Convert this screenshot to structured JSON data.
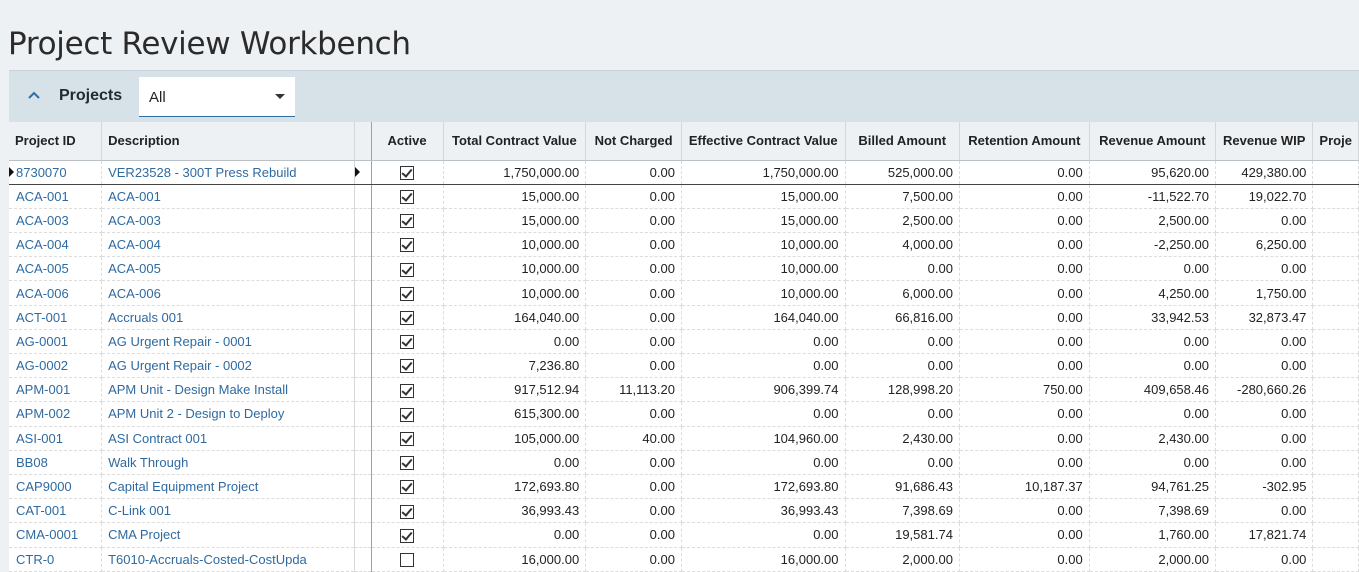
{
  "page": {
    "title": "Project Review Workbench"
  },
  "panel": {
    "title": "Projects",
    "filter_value": "All"
  },
  "grid": {
    "columns": [
      "Project ID",
      "Description",
      "Active",
      "Total Contract Value",
      "Not Charged",
      "Effective Contract Value",
      "Billed Amount",
      "Retention Amount",
      "Revenue Amount",
      "Revenue WIP",
      "Proje"
    ],
    "rows": [
      {
        "id": "8730070",
        "desc": "VER23528 - 300T Press Rebuild",
        "active": true,
        "tcv": "1,750,000.00",
        "nc": "0.00",
        "ecv": "1,750,000.00",
        "billed": "525,000.00",
        "ret": "0.00",
        "rev": "95,620.00",
        "wip": "429,380.00"
      },
      {
        "id": "ACA-001",
        "desc": "ACA-001",
        "active": true,
        "tcv": "15,000.00",
        "nc": "0.00",
        "ecv": "15,000.00",
        "billed": "7,500.00",
        "ret": "0.00",
        "rev": "-11,522.70",
        "wip": "19,022.70"
      },
      {
        "id": "ACA-003",
        "desc": "ACA-003",
        "active": true,
        "tcv": "15,000.00",
        "nc": "0.00",
        "ecv": "15,000.00",
        "billed": "2,500.00",
        "ret": "0.00",
        "rev": "2,500.00",
        "wip": "0.00"
      },
      {
        "id": "ACA-004",
        "desc": "ACA-004",
        "active": true,
        "tcv": "10,000.00",
        "nc": "0.00",
        "ecv": "10,000.00",
        "billed": "4,000.00",
        "ret": "0.00",
        "rev": "-2,250.00",
        "wip": "6,250.00"
      },
      {
        "id": "ACA-005",
        "desc": "ACA-005",
        "active": true,
        "tcv": "10,000.00",
        "nc": "0.00",
        "ecv": "10,000.00",
        "billed": "0.00",
        "ret": "0.00",
        "rev": "0.00",
        "wip": "0.00"
      },
      {
        "id": "ACA-006",
        "desc": "ACA-006",
        "active": true,
        "tcv": "10,000.00",
        "nc": "0.00",
        "ecv": "10,000.00",
        "billed": "6,000.00",
        "ret": "0.00",
        "rev": "4,250.00",
        "wip": "1,750.00"
      },
      {
        "id": "ACT-001",
        "desc": "Accruals 001",
        "active": true,
        "tcv": "164,040.00",
        "nc": "0.00",
        "ecv": "164,040.00",
        "billed": "66,816.00",
        "ret": "0.00",
        "rev": "33,942.53",
        "wip": "32,873.47"
      },
      {
        "id": "AG-0001",
        "desc": "AG Urgent Repair - 0001",
        "active": true,
        "tcv": "0.00",
        "nc": "0.00",
        "ecv": "0.00",
        "billed": "0.00",
        "ret": "0.00",
        "rev": "0.00",
        "wip": "0.00"
      },
      {
        "id": "AG-0002",
        "desc": "AG Urgent Repair - 0002",
        "active": true,
        "tcv": "7,236.80",
        "nc": "0.00",
        "ecv": "0.00",
        "billed": "0.00",
        "ret": "0.00",
        "rev": "0.00",
        "wip": "0.00"
      },
      {
        "id": "APM-001",
        "desc": "APM Unit - Design Make Install",
        "active": true,
        "tcv": "917,512.94",
        "nc": "11,113.20",
        "ecv": "906,399.74",
        "billed": "128,998.20",
        "ret": "750.00",
        "rev": "409,658.46",
        "wip": "-280,660.26"
      },
      {
        "id": "APM-002",
        "desc": "APM Unit 2 - Design to Deploy",
        "active": true,
        "tcv": "615,300.00",
        "nc": "0.00",
        "ecv": "0.00",
        "billed": "0.00",
        "ret": "0.00",
        "rev": "0.00",
        "wip": "0.00"
      },
      {
        "id": "ASI-001",
        "desc": "ASI Contract 001",
        "active": true,
        "tcv": "105,000.00",
        "nc": "40.00",
        "ecv": "104,960.00",
        "billed": "2,430.00",
        "ret": "0.00",
        "rev": "2,430.00",
        "wip": "0.00"
      },
      {
        "id": "BB08",
        "desc": "Walk Through",
        "active": true,
        "tcv": "0.00",
        "nc": "0.00",
        "ecv": "0.00",
        "billed": "0.00",
        "ret": "0.00",
        "rev": "0.00",
        "wip": "0.00"
      },
      {
        "id": "CAP9000",
        "desc": "Capital Equipment Project",
        "active": true,
        "tcv": "172,693.80",
        "nc": "0.00",
        "ecv": "172,693.80",
        "billed": "91,686.43",
        "ret": "10,187.37",
        "rev": "94,761.25",
        "wip": "-302.95"
      },
      {
        "id": "CAT-001",
        "desc": "C-Link 001",
        "active": true,
        "tcv": "36,993.43",
        "nc": "0.00",
        "ecv": "36,993.43",
        "billed": "7,398.69",
        "ret": "0.00",
        "rev": "7,398.69",
        "wip": "0.00"
      },
      {
        "id": "CMA-0001",
        "desc": "CMA Project",
        "active": true,
        "tcv": "0.00",
        "nc": "0.00",
        "ecv": "0.00",
        "billed": "19,581.74",
        "ret": "0.00",
        "rev": "1,760.00",
        "wip": "17,821.74"
      },
      {
        "id": "CTR-0",
        "desc": "T6010-Accruals-Costed-CostUpda",
        "active": false,
        "tcv": "16,000.00",
        "nc": "0.00",
        "ecv": "16,000.00",
        "billed": "2,000.00",
        "ret": "0.00",
        "rev": "2,000.00",
        "wip": "0.00"
      }
    ]
  }
}
